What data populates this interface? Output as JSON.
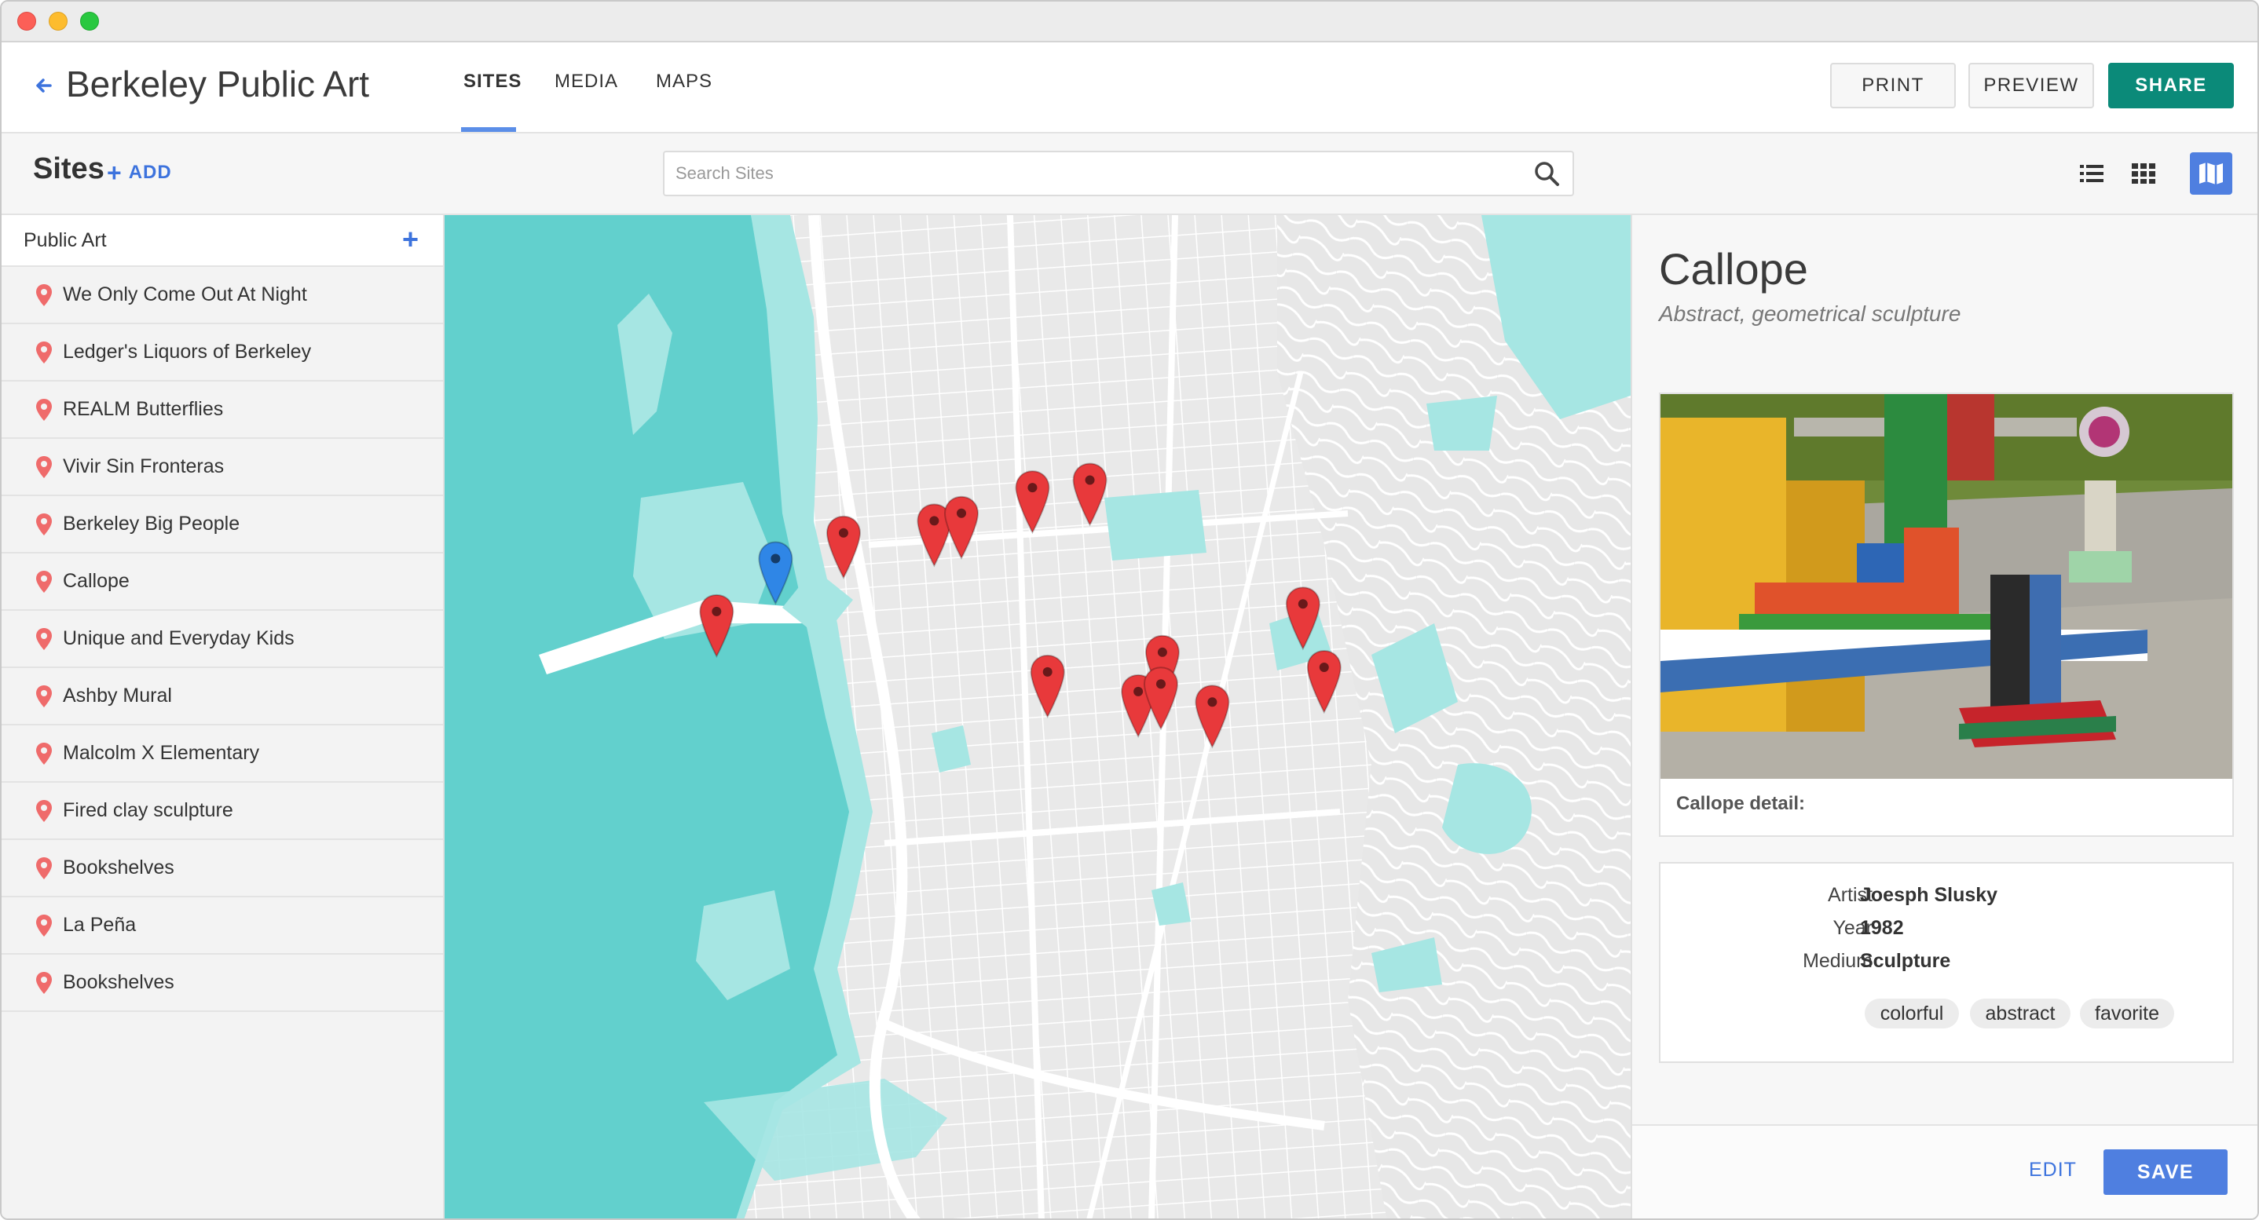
{
  "header": {
    "back_icon": "arrow-left-icon",
    "title": "Berkeley Public Art",
    "tabs": [
      {
        "label": "SITES",
        "active": true
      },
      {
        "label": "MEDIA",
        "active": false
      },
      {
        "label": "MAPS",
        "active": false
      }
    ],
    "buttons": {
      "print": "PRINT",
      "preview": "PREVIEW",
      "share": "SHARE"
    },
    "colors": {
      "share": "#0b8a79",
      "accent": "#4f7fe0"
    }
  },
  "subheader": {
    "title": "Sites",
    "add_label": "ADD",
    "search_placeholder": "Search Sites",
    "view_icons": [
      "list-view-icon",
      "grid-view-icon",
      "map-view-icon"
    ],
    "active_view": "map-view-icon"
  },
  "sidebar": {
    "group_label": "Public Art",
    "items": [
      {
        "label": "We Only Come Out At Night"
      },
      {
        "label": "Ledger's Liquors of Berkeley"
      },
      {
        "label": "REALM Butterflies"
      },
      {
        "label": "Vivir Sin Fronteras"
      },
      {
        "label": "Berkeley Big People"
      },
      {
        "label": "Callope"
      },
      {
        "label": "Unique and Everyday Kids"
      },
      {
        "label": "Ashby Mural"
      },
      {
        "label": "Malcolm X Elementary"
      },
      {
        "label": "Fired clay sculpture"
      },
      {
        "label": "Bookshelves"
      },
      {
        "label": "La Peña"
      },
      {
        "label": "Bookshelves"
      }
    ]
  },
  "map": {
    "marker_colors": {
      "default": "#e8393b",
      "selected": "#2f86e6"
    },
    "water_color": "#62d0cd"
  },
  "detail": {
    "title": "Callope",
    "subtitle": "Abstract, geometrical sculpture",
    "caption": "Callope detail:",
    "fields": [
      {
        "key": "Artist",
        "value": "Joesph Slusky"
      },
      {
        "key": "Year",
        "value": "1982"
      },
      {
        "key": "Medium",
        "value": "Sculpture"
      }
    ],
    "tags": [
      "colorful",
      "abstract",
      "favorite"
    ],
    "edit_label": "EDIT",
    "save_label": "SAVE"
  }
}
